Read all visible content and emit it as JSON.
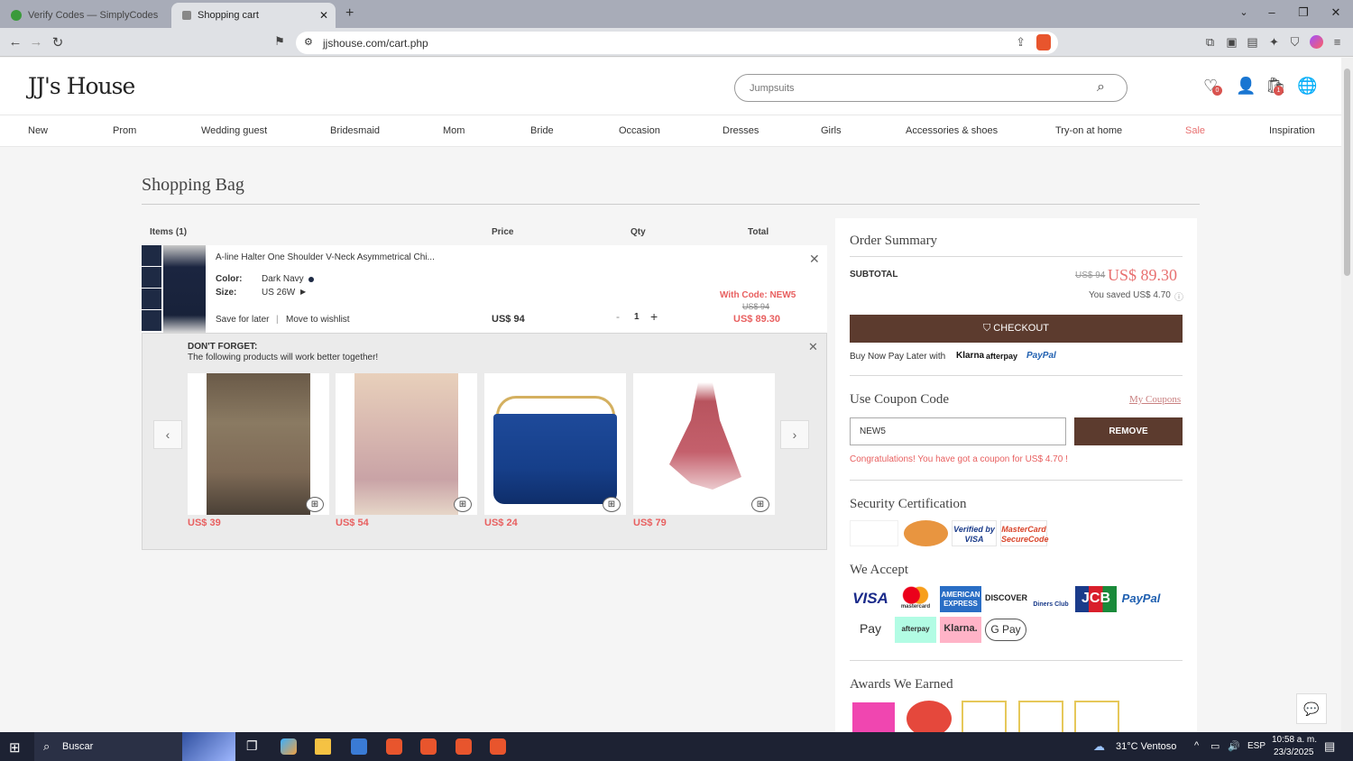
{
  "browser": {
    "tabs": [
      {
        "label": "Verify Codes — SimplyCodes",
        "active": false
      },
      {
        "label": "Shopping cart",
        "active": true
      }
    ],
    "url": "jjshouse.com/cart.php"
  },
  "header": {
    "logo": "JJ's House",
    "search_placeholder": "Jumpsuits",
    "wishlist_count": "0",
    "cart_count": "1"
  },
  "menu": [
    "New",
    "Prom",
    "Wedding guest",
    "Bridesmaid",
    "Mom",
    "Bride",
    "Occasion",
    "Dresses",
    "Girls",
    "Accessories & shoes",
    "Try-on at home",
    "Sale",
    "Inspiration"
  ],
  "bag": {
    "title": "Shopping Bag",
    "col_items": "Items (1)",
    "col_price": "Price",
    "col_qty": "Qty",
    "col_total": "Total",
    "item": {
      "name": "A-line Halter One Shoulder V-Neck Asymmetrical Chi...",
      "color_label": "Color:",
      "color_value": "Dark Navy",
      "size_label": "Size:",
      "size_value": "US 26W",
      "save_later": "Save for later",
      "separator": "|",
      "move_wishlist": "Move to wishlist",
      "price": "US$ 94",
      "qty": "1",
      "minus": "-",
      "plus": "+",
      "with_code": "With Code: NEW5",
      "old_total": "US$ 94",
      "total": "US$ 89.30"
    }
  },
  "forget": {
    "title": "DON'T FORGET:",
    "subtitle": "The following products will work better together!",
    "products": [
      {
        "price": "US$ 39"
      },
      {
        "price": "US$ 54"
      },
      {
        "price": "US$ 24"
      },
      {
        "price": "US$ 79"
      }
    ]
  },
  "summary": {
    "title": "Order Summary",
    "subtotal_label": "SUBTOTAL",
    "subtotal_old": "US$ 94",
    "subtotal_new": "US$ 89.30",
    "saved": "You saved US$ 4.70",
    "checkout": "CHECKOUT",
    "bnpl": "Buy Now Pay Later with",
    "bnpl_brands": [
      "Klarna",
      "afterpay",
      "PayPal"
    ],
    "coupon_title": "Use Coupon Code",
    "my_coupons": "My Coupons",
    "coupon_value": "NEW5",
    "remove": "REMOVE",
    "congrats": "Congratulations! You have got a coupon for US$ 4.70 !",
    "security_title": "Security Certification",
    "security_badges": [
      "Verified by VISA",
      "MasterCard SecureCode"
    ],
    "accept_title": "We Accept",
    "cards": [
      "VISA",
      "mastercard",
      "AMERICAN EXPRESS",
      "DISCOVER",
      "Diners Club",
      "JCB",
      "PayPal",
      "Pay",
      "afterpay",
      "Klarna.",
      "G Pay"
    ],
    "awards_title": "Awards We Earned"
  },
  "taskbar": {
    "search": "Buscar",
    "weather": "31°C  Ventoso",
    "lang": "ESP",
    "time": "10:58 a. m.",
    "date": "23/3/2025"
  },
  "colors": {
    "brown": "#5c3b2e",
    "red": "#e86060",
    "sale": "#e87070"
  }
}
